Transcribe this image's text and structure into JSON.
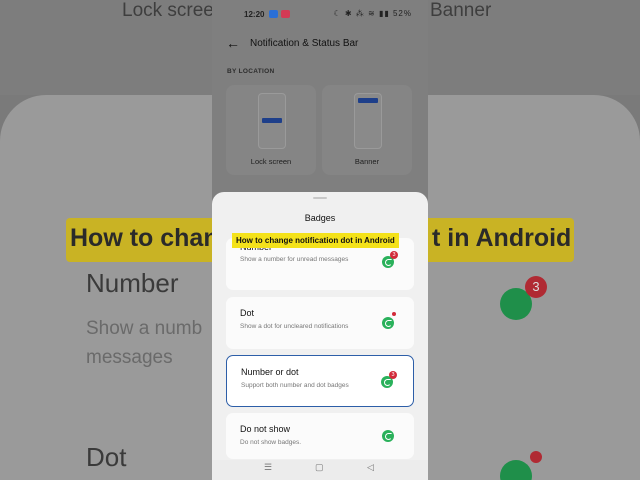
{
  "background": {
    "lock_text": "Lock scree",
    "banner_text": "Banner",
    "highlight_left": "How to chan",
    "highlight_right": "t in Android",
    "number_title": "Number",
    "number_sub": "Show a numb\nmessages",
    "dot_title": "Dot",
    "badge_count": "3"
  },
  "status_bar": {
    "time": "12:20",
    "right": "☾ ✱ ⁂ ≋ ▮▮ 52%"
  },
  "header": {
    "back_icon": "arrow-left",
    "title": "Notification & Status Bar"
  },
  "section_label": "BY LOCATION",
  "location_cards": [
    {
      "label": "Lock screen"
    },
    {
      "label": "Banner"
    }
  ],
  "sheet": {
    "title": "Badges",
    "caption": "How to change notification dot in Android",
    "options": [
      {
        "title": "Number",
        "desc": "Show a number for unread messages",
        "indicator": "badge",
        "badge": "3",
        "selected": false
      },
      {
        "title": "Dot",
        "desc": "Show a dot for uncleared notifications",
        "indicator": "dot",
        "selected": false
      },
      {
        "title": "Number or dot",
        "desc": "Support both number and dot badges",
        "indicator": "badge",
        "badge": "3",
        "selected": true
      },
      {
        "title": "Do not show",
        "desc": "Do not show badges.",
        "indicator": "none",
        "selected": false
      }
    ]
  },
  "nav": {
    "menu": "☰",
    "home": "▢",
    "back": "◁"
  },
  "colors": {
    "accent": "#2d5ea8",
    "badge": "#d22b3a",
    "whatsapp": "#2ab15b",
    "caption_bg": "#f4e21a"
  }
}
